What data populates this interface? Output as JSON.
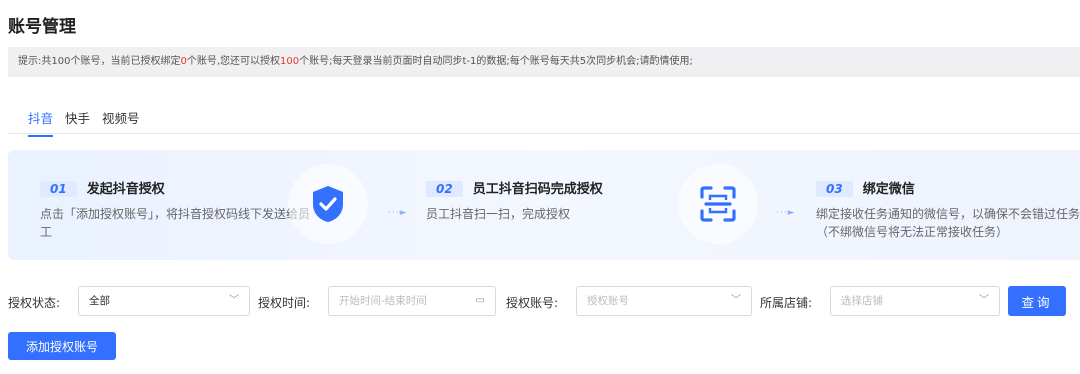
{
  "page": {
    "title": "账号管理"
  },
  "notice": {
    "part1": "提示:共100个账号，当前已授权绑定",
    "bound": "0",
    "part2": "个账号,您还可以授权",
    "remaining": "100",
    "part3": "个账号;每天登录当前页面时自动同步t-1的数据;每个账号每天共5次同步机会;请酌情使用;"
  },
  "tabs": [
    {
      "label": "抖音",
      "active": true
    },
    {
      "label": "快手",
      "active": false
    },
    {
      "label": "视频号",
      "active": false
    }
  ],
  "steps": [
    {
      "num": "01",
      "title": "发起抖音授权",
      "desc": "点击「添加授权账号」，将抖音授权码线下发送给员工"
    },
    {
      "num": "02",
      "title": "员工抖音扫码完成授权",
      "desc": "员工抖音扫一扫，完成授权"
    },
    {
      "num": "03",
      "title": "绑定微信",
      "desc": "绑定接收任务通知的微信号，以确保不会错过任务（不绑微信号将无法正常接收任务）"
    }
  ],
  "filters": {
    "status_label": "授权状态:",
    "status_value": "全部",
    "time_label": "授权时间:",
    "time_placeholder": "开始时间-结束时间",
    "account_label": "授权账号:",
    "account_placeholder": "授权账号",
    "store_label": "所属店铺:",
    "store_placeholder": "选择店铺",
    "query_label": "查询"
  },
  "add_button": "添加授权账号",
  "colors": {
    "accent": "#3370ff",
    "highlight": "#e53935"
  }
}
